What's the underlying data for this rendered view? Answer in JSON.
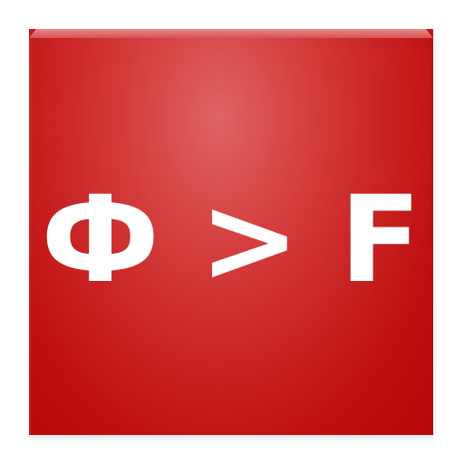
{
  "app_icon": {
    "left_symbol": "Ф",
    "operator": ">",
    "right_symbol": "F"
  },
  "colors": {
    "background": "#ffffff",
    "tile_highlight": "#dd6565",
    "tile_base": "#b70808",
    "text": "#ffffff"
  }
}
